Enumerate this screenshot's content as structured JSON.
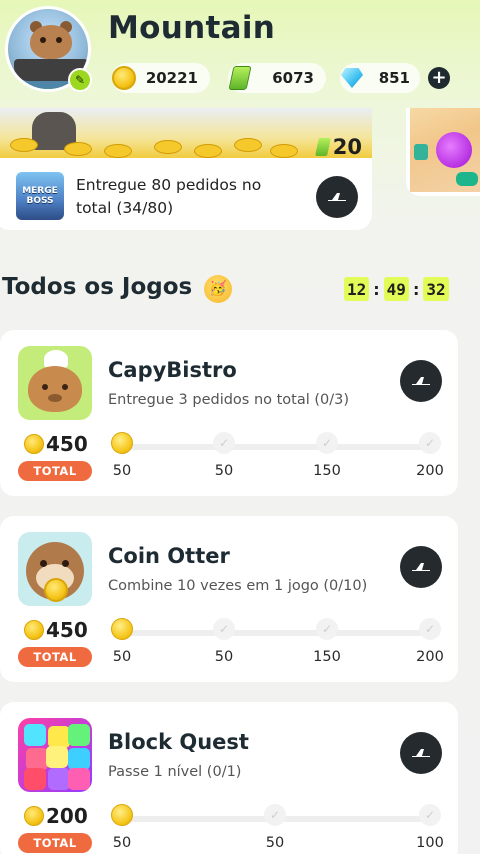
{
  "profile": {
    "username": "Mountain",
    "edit_icon": "pencil-icon"
  },
  "currencies": [
    {
      "name": "coins",
      "icon": "coin-icon",
      "value": "20221"
    },
    {
      "name": "cash",
      "icon": "cash-icon",
      "value": "6073"
    },
    {
      "name": "gems",
      "icon": "gem-icon",
      "value": "851"
    }
  ],
  "add_currency_label": "+",
  "banner": {
    "reward": "20",
    "thumb_text": "MERGE BOSS",
    "task_text": "Entregue 80 pedidos no total (34/80)"
  },
  "section": {
    "title": "Todos os Jogos",
    "emoji": "🥳",
    "timer": {
      "hours": "12",
      "minutes": "49",
      "seconds": "32",
      "separator": ":"
    }
  },
  "games": [
    {
      "name": "CapyBistro",
      "task": "Entregue 3 pedidos no total (0/3)",
      "reward": "450",
      "total_label": "TOTAL",
      "milestones": [
        "50",
        "50",
        "150",
        "200"
      ]
    },
    {
      "name": "Coin Otter",
      "task": "Combine 10 vezes em 1 jogo (0/10)",
      "reward": "450",
      "total_label": "TOTAL",
      "milestones": [
        "50",
        "50",
        "150",
        "200"
      ]
    },
    {
      "name": "Block Quest",
      "task": "Passe 1 nível (0/1)",
      "reward": "200",
      "total_label": "TOTAL",
      "milestones": [
        "50",
        "50",
        "100"
      ]
    }
  ],
  "colors": {
    "accent_green": "#9bd81f",
    "timer_bg": "#e3fb57",
    "total_badge": "#f06a3f",
    "button_dark": "#252a2e"
  }
}
